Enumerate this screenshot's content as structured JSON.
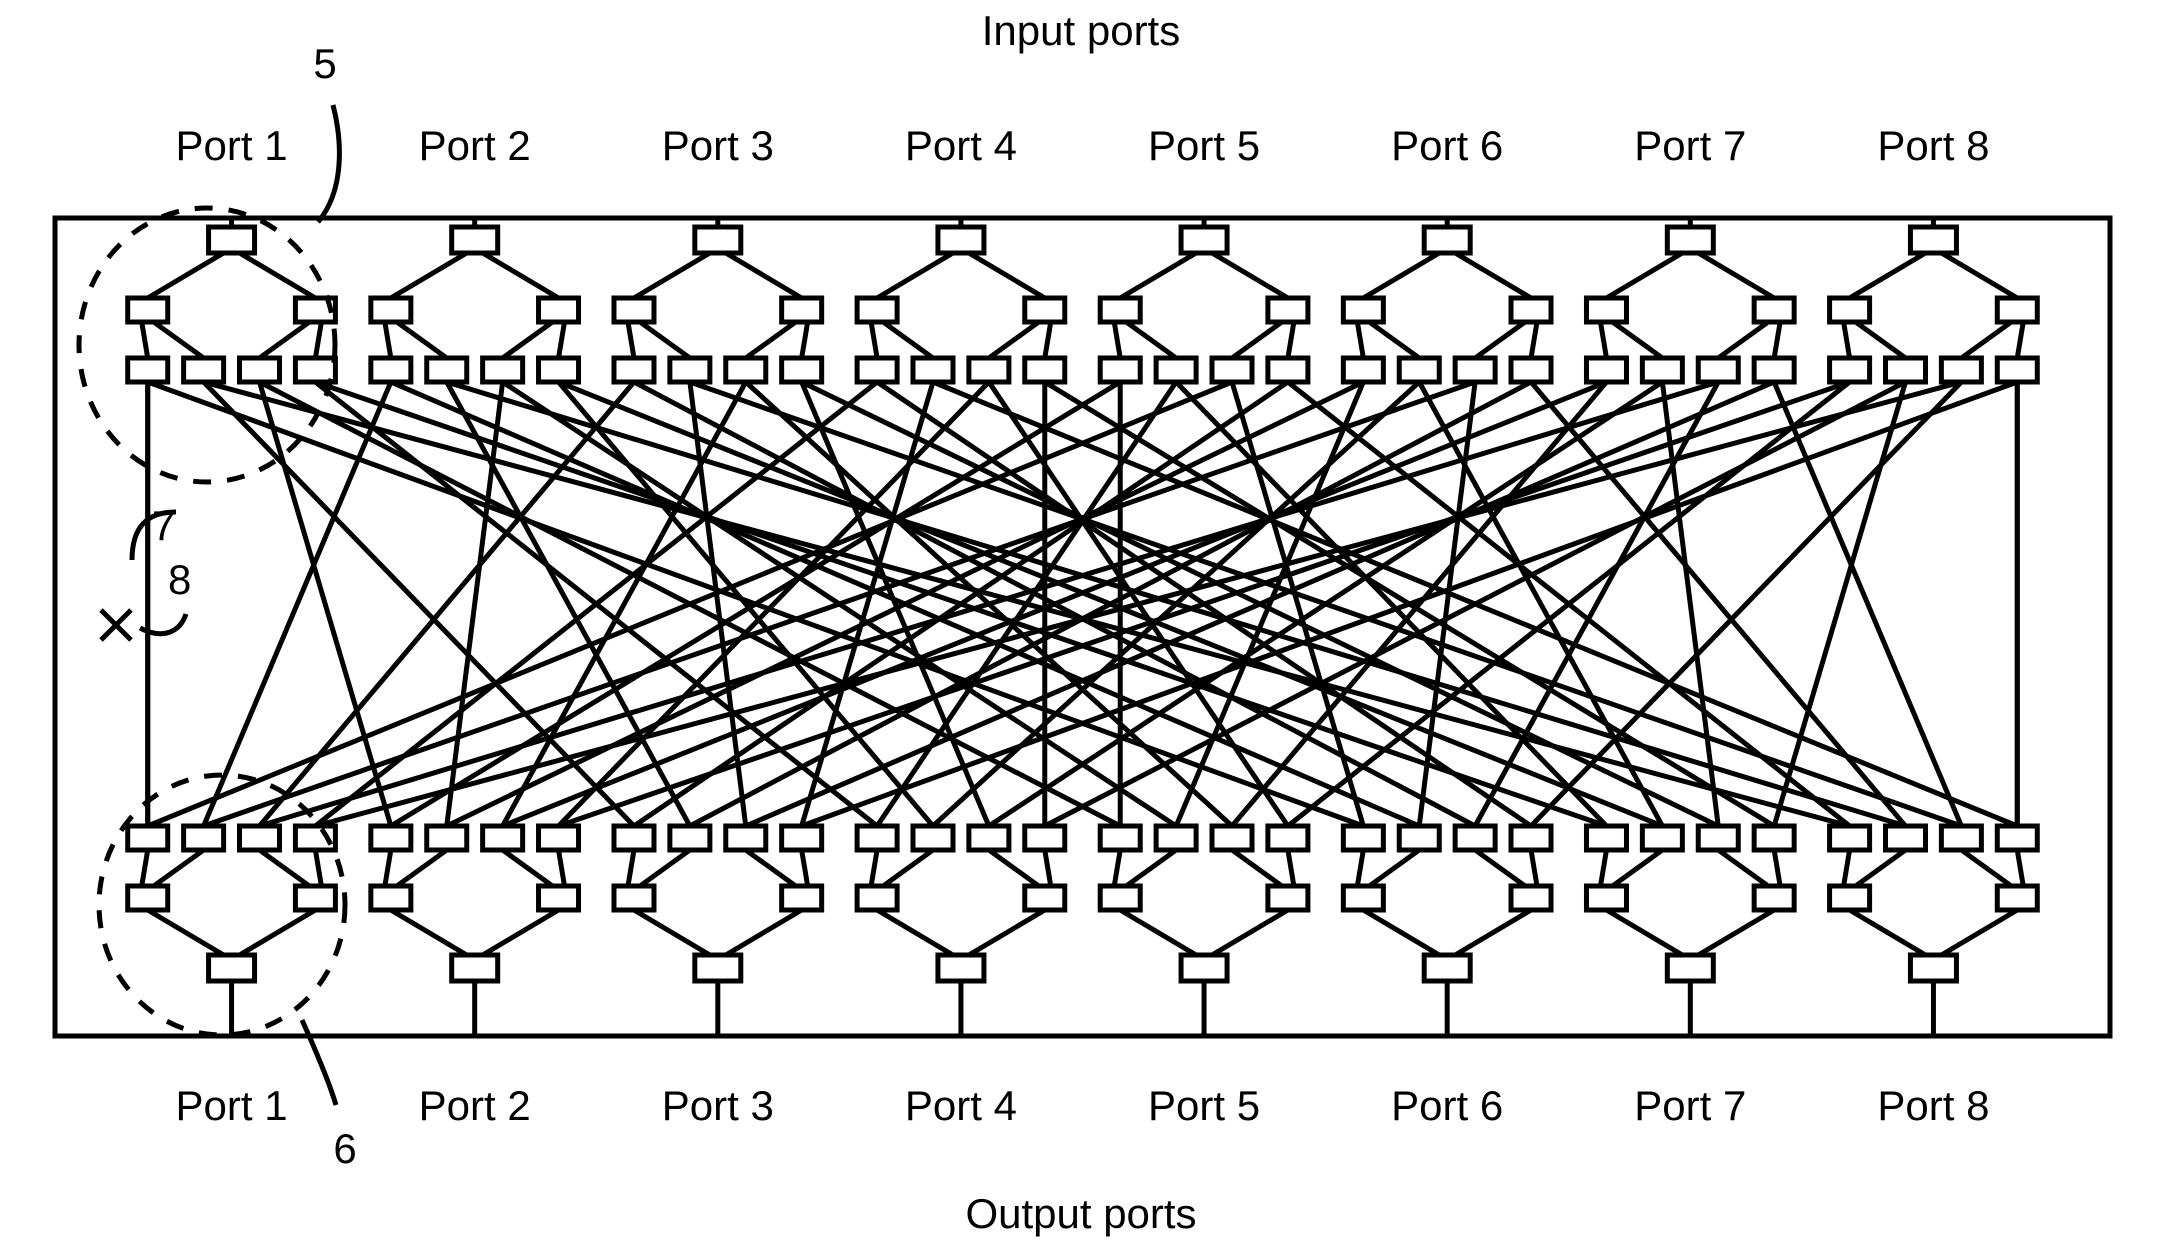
{
  "figure": {
    "kind": "patent-diagram",
    "title_top": "Input ports",
    "title_bottom": "Output ports",
    "line_color": "#000000",
    "background_color": "#ffffff"
  },
  "input_ports": {
    "heading": "Input ports",
    "labels": [
      "Port 1",
      "Port 2",
      "Port 3",
      "Port 4",
      "Port 5",
      "Port 6",
      "Port 7",
      "Port 8"
    ]
  },
  "output_ports": {
    "heading": "Output ports",
    "labels": [
      "Port 1",
      "Port 2",
      "Port 3",
      "Port 4",
      "Port 5",
      "Port 6",
      "Port 7",
      "Port 8"
    ]
  },
  "reference_numerals": [
    {
      "id": "5",
      "label": "5",
      "points_to": "input-port-1-group"
    },
    {
      "id": "6",
      "label": "6",
      "points_to": "output-port-1-group"
    },
    {
      "id": "7",
      "label": "7",
      "points_to": "interconnect-link"
    },
    {
      "id": "8",
      "label": "8",
      "points_to": "link-fault-marker"
    }
  ],
  "topology": {
    "port_count": 8,
    "tree_levels": 3,
    "level_box_counts": [
      1,
      2,
      4
    ],
    "crossbar_nodes_per_side": 32,
    "fanout": 2
  }
}
